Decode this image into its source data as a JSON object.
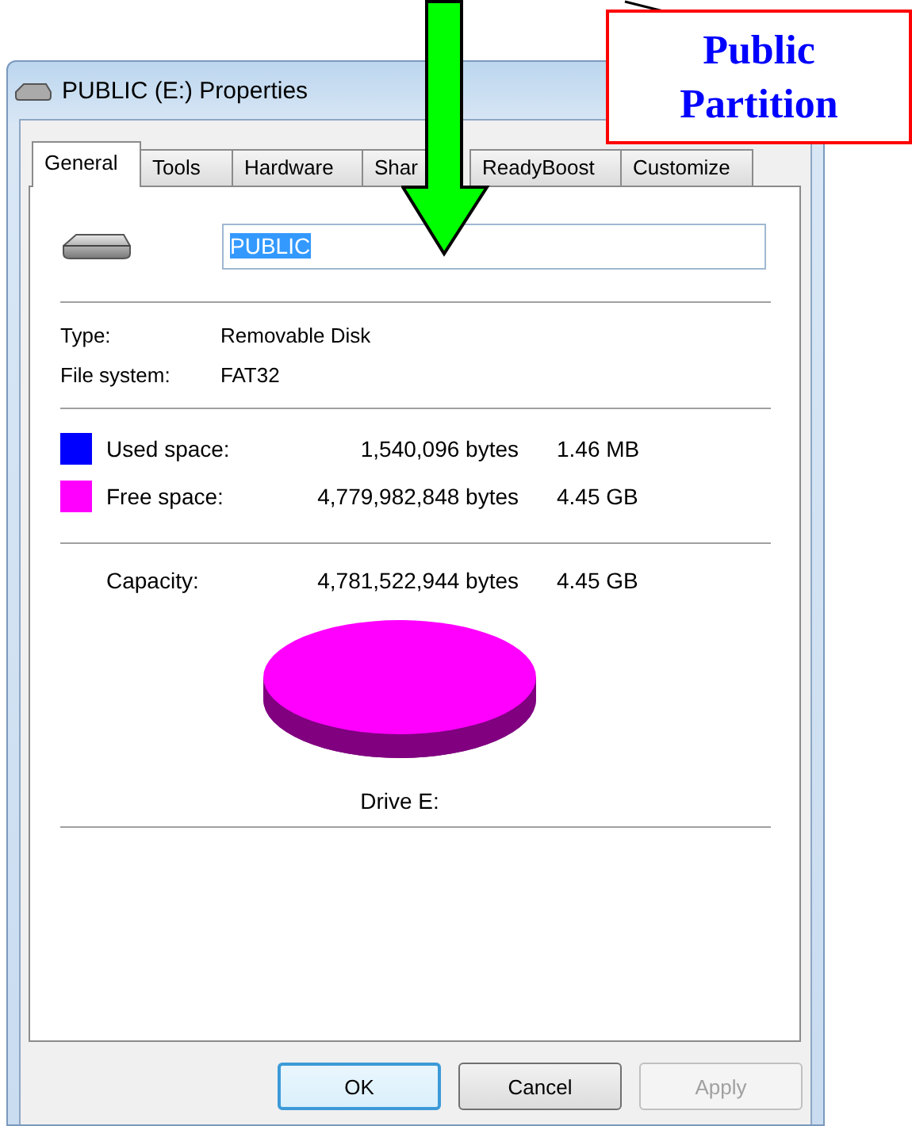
{
  "window": {
    "title": "PUBLIC (E:) Properties"
  },
  "tabs": [
    {
      "label": "General",
      "selected": true
    },
    {
      "label": "Tools",
      "selected": false
    },
    {
      "label": "Hardware",
      "selected": false
    },
    {
      "label": "Shar",
      "selected": false
    },
    {
      "label": "ReadyBoost",
      "selected": false
    },
    {
      "label": "Customize",
      "selected": false
    }
  ],
  "name_field": {
    "value": "PUBLIC",
    "text_selected": true
  },
  "info": [
    {
      "label": "Type:",
      "value": "Removable Disk"
    },
    {
      "label": "File system:",
      "value": "FAT32"
    }
  ],
  "space": [
    {
      "kind": "legend",
      "label": "Used space:",
      "bytes": "1,540,096 bytes",
      "size": "1.46 MB",
      "color": "#0000ff"
    },
    {
      "kind": "legend",
      "label": "Free space:",
      "bytes": "4,779,982,848 bytes",
      "size": "4.45 GB",
      "color": "#ff00ff"
    },
    {
      "kind": "total",
      "label": "Capacity:",
      "bytes": "4,781,522,944 bytes",
      "size": "4.45 GB"
    }
  ],
  "drive_label": "Drive E:",
  "buttons": [
    {
      "label": "OK",
      "default": true,
      "disabled": false
    },
    {
      "label": "Cancel",
      "default": false,
      "disabled": false
    },
    {
      "label": "Apply",
      "default": false,
      "disabled": true
    }
  ],
  "callout": {
    "lines": [
      "Public",
      "Partition"
    ]
  }
}
